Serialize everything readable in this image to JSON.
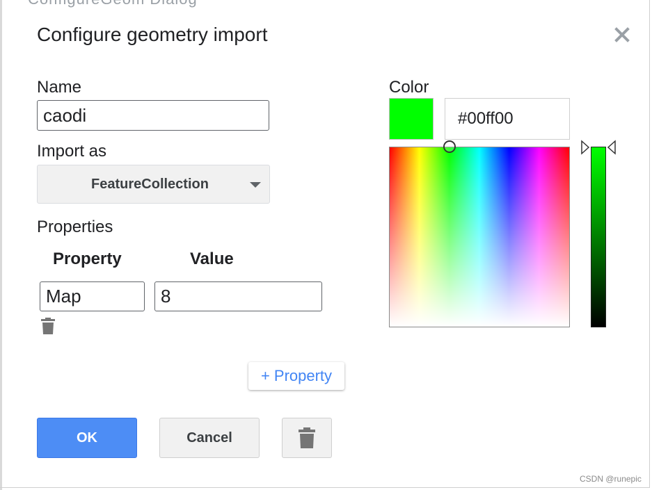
{
  "backdrop": {
    "text": "ConfigureGeom   Dialog"
  },
  "dialog": {
    "title": "Configure geometry import",
    "close_icon": "close-icon",
    "name": {
      "label": "Name",
      "value": "caodi"
    },
    "import_as": {
      "label": "Import as",
      "selected": "FeatureCollection"
    },
    "properties": {
      "label": "Properties",
      "columns": [
        "Property",
        "Value"
      ],
      "rows": [
        {
          "property": "Map",
          "value": "8"
        }
      ],
      "add_label": "+ Property"
    },
    "color": {
      "label": "Color",
      "hex": "#00ff00",
      "hex_display": "#00ff00"
    },
    "buttons": {
      "ok": "OK",
      "cancel": "Cancel",
      "delete_icon": "trash-icon"
    }
  },
  "watermark": "CSDN @runepic",
  "colors": {
    "accent": "#4d8df5",
    "link": "#4285f4"
  }
}
